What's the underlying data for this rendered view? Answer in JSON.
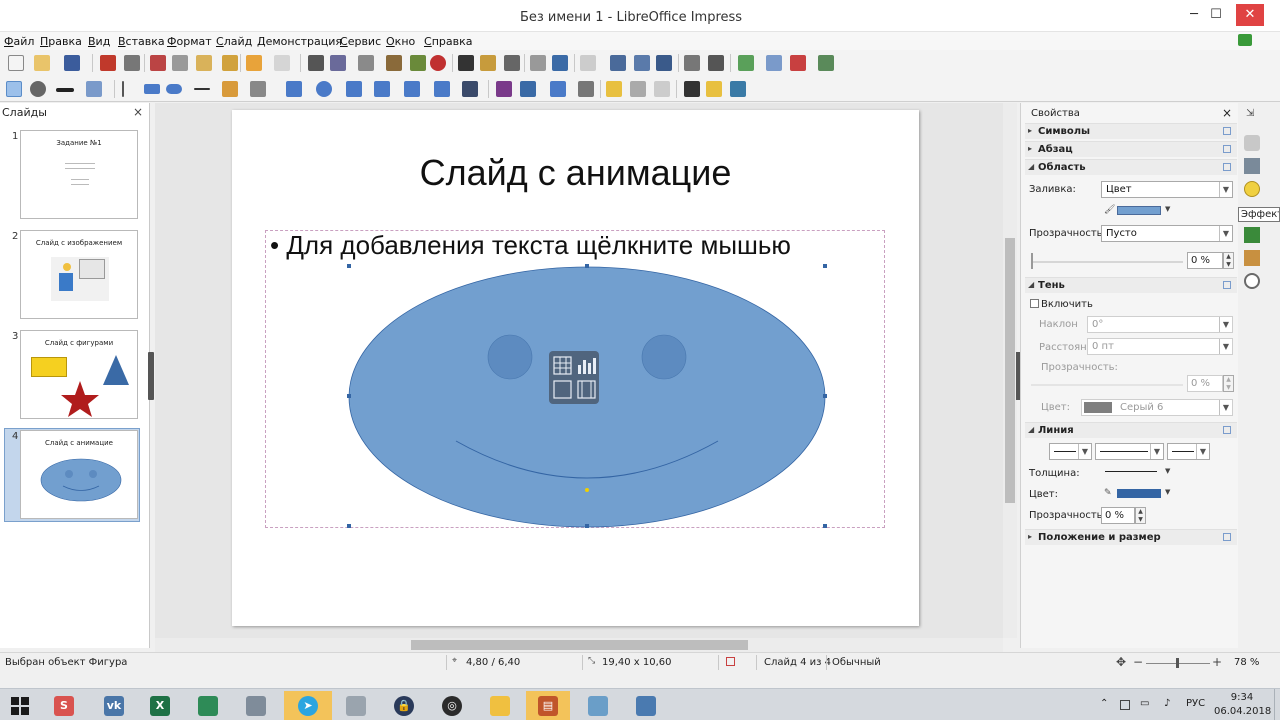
{
  "window": {
    "title": "Без имени 1 - LibreOffice Impress",
    "minimize": "─",
    "maximize": "☐",
    "close": "✕"
  },
  "menu": [
    "Файл",
    "Правка",
    "Вид",
    "Вставка",
    "Формат",
    "Слайд",
    "Демонстрация",
    "Сервис",
    "Окно",
    "Справка"
  ],
  "slides_pane": {
    "header": "Слайды",
    "close": "×",
    "thumbs": [
      {
        "number": "1",
        "title": "Задание №1"
      },
      {
        "number": "2",
        "title": "Слайд с изображением"
      },
      {
        "number": "3",
        "title": "Слайд с фигурами"
      },
      {
        "number": "4",
        "title": "Слайд с анимацие"
      }
    ]
  },
  "slide": {
    "title": "Слайд с анимацие",
    "placeholder": "• Для добавления текста щёлкните мышью",
    "face_color": "#729fcf",
    "face_stroke": "#3465a4"
  },
  "sidebar": {
    "title": "Свойства",
    "close": "×",
    "sections": {
      "symbols": "Символы",
      "paragraph": "Абзац",
      "area": "Область",
      "shadow": "Тень",
      "line": "Линия",
      "position": "Положение и размер"
    },
    "area": {
      "fill_label": "Заливка:",
      "fill_value": "Цвет",
      "transparency_label": "Прозрачность:",
      "transparency_value": "Пусто",
      "transparency_pct": "0 %"
    },
    "shadow": {
      "enable_label": "Включить",
      "angle_label": "Наклон",
      "angle_value": "0°",
      "distance_label": "Расстояние",
      "distance_value": "0 пт",
      "transparency_label": "Прозрачность:",
      "transparency_pct": "0 %",
      "color_label": "Цвет:",
      "color_value": "Серый 6"
    },
    "line": {
      "width_label": "Толщина:",
      "color_label": "Цвет:",
      "transparency_label": "Прозрачность:",
      "transparency_pct": "0 %"
    },
    "tooltip": "Эффекты"
  },
  "statusbar": {
    "selection": "Выбран объект Фигура",
    "position": "4,80 / 6,40",
    "size": "19,40 x 10,60",
    "slide": "Слайд 4 из 4",
    "layout": "Обычный",
    "zoom": "78 %"
  },
  "taskbar": {
    "lang": "РУС",
    "time": "9:34",
    "date": "06.04.2018",
    "apps": [
      "windows",
      "skype",
      "vk",
      "excel",
      "sway",
      "calculator",
      "telegram",
      "scanner",
      "vpn",
      "obs",
      "explorer",
      "impress",
      "notes",
      "photos"
    ]
  }
}
